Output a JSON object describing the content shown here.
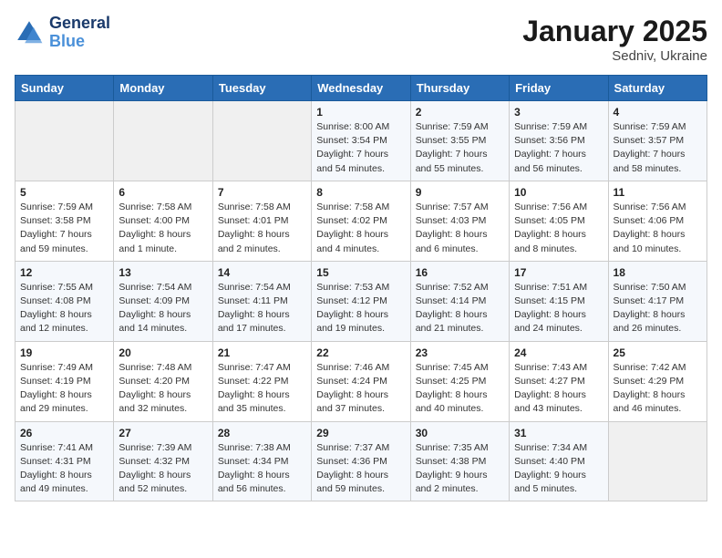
{
  "logo": {
    "line1": "General",
    "line2": "Blue"
  },
  "title": "January 2025",
  "subtitle": "Sedniv, Ukraine",
  "headers": [
    "Sunday",
    "Monday",
    "Tuesday",
    "Wednesday",
    "Thursday",
    "Friday",
    "Saturday"
  ],
  "weeks": [
    [
      {
        "day": "",
        "info": ""
      },
      {
        "day": "",
        "info": ""
      },
      {
        "day": "",
        "info": ""
      },
      {
        "day": "1",
        "info": "Sunrise: 8:00 AM\nSunset: 3:54 PM\nDaylight: 7 hours\nand 54 minutes."
      },
      {
        "day": "2",
        "info": "Sunrise: 7:59 AM\nSunset: 3:55 PM\nDaylight: 7 hours\nand 55 minutes."
      },
      {
        "day": "3",
        "info": "Sunrise: 7:59 AM\nSunset: 3:56 PM\nDaylight: 7 hours\nand 56 minutes."
      },
      {
        "day": "4",
        "info": "Sunrise: 7:59 AM\nSunset: 3:57 PM\nDaylight: 7 hours\nand 58 minutes."
      }
    ],
    [
      {
        "day": "5",
        "info": "Sunrise: 7:59 AM\nSunset: 3:58 PM\nDaylight: 7 hours\nand 59 minutes."
      },
      {
        "day": "6",
        "info": "Sunrise: 7:58 AM\nSunset: 4:00 PM\nDaylight: 8 hours\nand 1 minute."
      },
      {
        "day": "7",
        "info": "Sunrise: 7:58 AM\nSunset: 4:01 PM\nDaylight: 8 hours\nand 2 minutes."
      },
      {
        "day": "8",
        "info": "Sunrise: 7:58 AM\nSunset: 4:02 PM\nDaylight: 8 hours\nand 4 minutes."
      },
      {
        "day": "9",
        "info": "Sunrise: 7:57 AM\nSunset: 4:03 PM\nDaylight: 8 hours\nand 6 minutes."
      },
      {
        "day": "10",
        "info": "Sunrise: 7:56 AM\nSunset: 4:05 PM\nDaylight: 8 hours\nand 8 minutes."
      },
      {
        "day": "11",
        "info": "Sunrise: 7:56 AM\nSunset: 4:06 PM\nDaylight: 8 hours\nand 10 minutes."
      }
    ],
    [
      {
        "day": "12",
        "info": "Sunrise: 7:55 AM\nSunset: 4:08 PM\nDaylight: 8 hours\nand 12 minutes."
      },
      {
        "day": "13",
        "info": "Sunrise: 7:54 AM\nSunset: 4:09 PM\nDaylight: 8 hours\nand 14 minutes."
      },
      {
        "day": "14",
        "info": "Sunrise: 7:54 AM\nSunset: 4:11 PM\nDaylight: 8 hours\nand 17 minutes."
      },
      {
        "day": "15",
        "info": "Sunrise: 7:53 AM\nSunset: 4:12 PM\nDaylight: 8 hours\nand 19 minutes."
      },
      {
        "day": "16",
        "info": "Sunrise: 7:52 AM\nSunset: 4:14 PM\nDaylight: 8 hours\nand 21 minutes."
      },
      {
        "day": "17",
        "info": "Sunrise: 7:51 AM\nSunset: 4:15 PM\nDaylight: 8 hours\nand 24 minutes."
      },
      {
        "day": "18",
        "info": "Sunrise: 7:50 AM\nSunset: 4:17 PM\nDaylight: 8 hours\nand 26 minutes."
      }
    ],
    [
      {
        "day": "19",
        "info": "Sunrise: 7:49 AM\nSunset: 4:19 PM\nDaylight: 8 hours\nand 29 minutes."
      },
      {
        "day": "20",
        "info": "Sunrise: 7:48 AM\nSunset: 4:20 PM\nDaylight: 8 hours\nand 32 minutes."
      },
      {
        "day": "21",
        "info": "Sunrise: 7:47 AM\nSunset: 4:22 PM\nDaylight: 8 hours\nand 35 minutes."
      },
      {
        "day": "22",
        "info": "Sunrise: 7:46 AM\nSunset: 4:24 PM\nDaylight: 8 hours\nand 37 minutes."
      },
      {
        "day": "23",
        "info": "Sunrise: 7:45 AM\nSunset: 4:25 PM\nDaylight: 8 hours\nand 40 minutes."
      },
      {
        "day": "24",
        "info": "Sunrise: 7:43 AM\nSunset: 4:27 PM\nDaylight: 8 hours\nand 43 minutes."
      },
      {
        "day": "25",
        "info": "Sunrise: 7:42 AM\nSunset: 4:29 PM\nDaylight: 8 hours\nand 46 minutes."
      }
    ],
    [
      {
        "day": "26",
        "info": "Sunrise: 7:41 AM\nSunset: 4:31 PM\nDaylight: 8 hours\nand 49 minutes."
      },
      {
        "day": "27",
        "info": "Sunrise: 7:39 AM\nSunset: 4:32 PM\nDaylight: 8 hours\nand 52 minutes."
      },
      {
        "day": "28",
        "info": "Sunrise: 7:38 AM\nSunset: 4:34 PM\nDaylight: 8 hours\nand 56 minutes."
      },
      {
        "day": "29",
        "info": "Sunrise: 7:37 AM\nSunset: 4:36 PM\nDaylight: 8 hours\nand 59 minutes."
      },
      {
        "day": "30",
        "info": "Sunrise: 7:35 AM\nSunset: 4:38 PM\nDaylight: 9 hours\nand 2 minutes."
      },
      {
        "day": "31",
        "info": "Sunrise: 7:34 AM\nSunset: 4:40 PM\nDaylight: 9 hours\nand 5 minutes."
      },
      {
        "day": "",
        "info": ""
      }
    ]
  ]
}
